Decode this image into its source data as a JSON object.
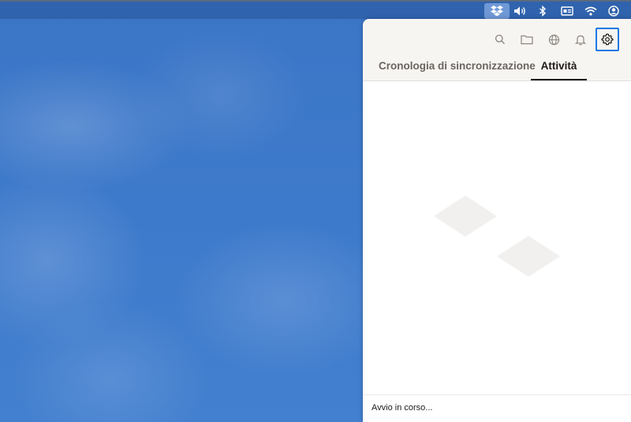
{
  "menubar": {
    "icons": [
      "dropbox-icon",
      "volume-icon",
      "bluetooth-icon",
      "display-icon",
      "wifi-icon",
      "user-icon"
    ]
  },
  "panel": {
    "toolbar": {
      "icons": [
        "search-icon",
        "folder-icon",
        "globe-icon",
        "bell-icon",
        "gear-icon"
      ],
      "focused": "gear-icon",
      "focus_color": "#1e78e6"
    },
    "tabs": [
      {
        "label": "Cronologia di sincronizzazione",
        "active": false
      },
      {
        "label": "Attività",
        "active": true
      }
    ],
    "status": {
      "text": "Avvio in corso..."
    }
  }
}
